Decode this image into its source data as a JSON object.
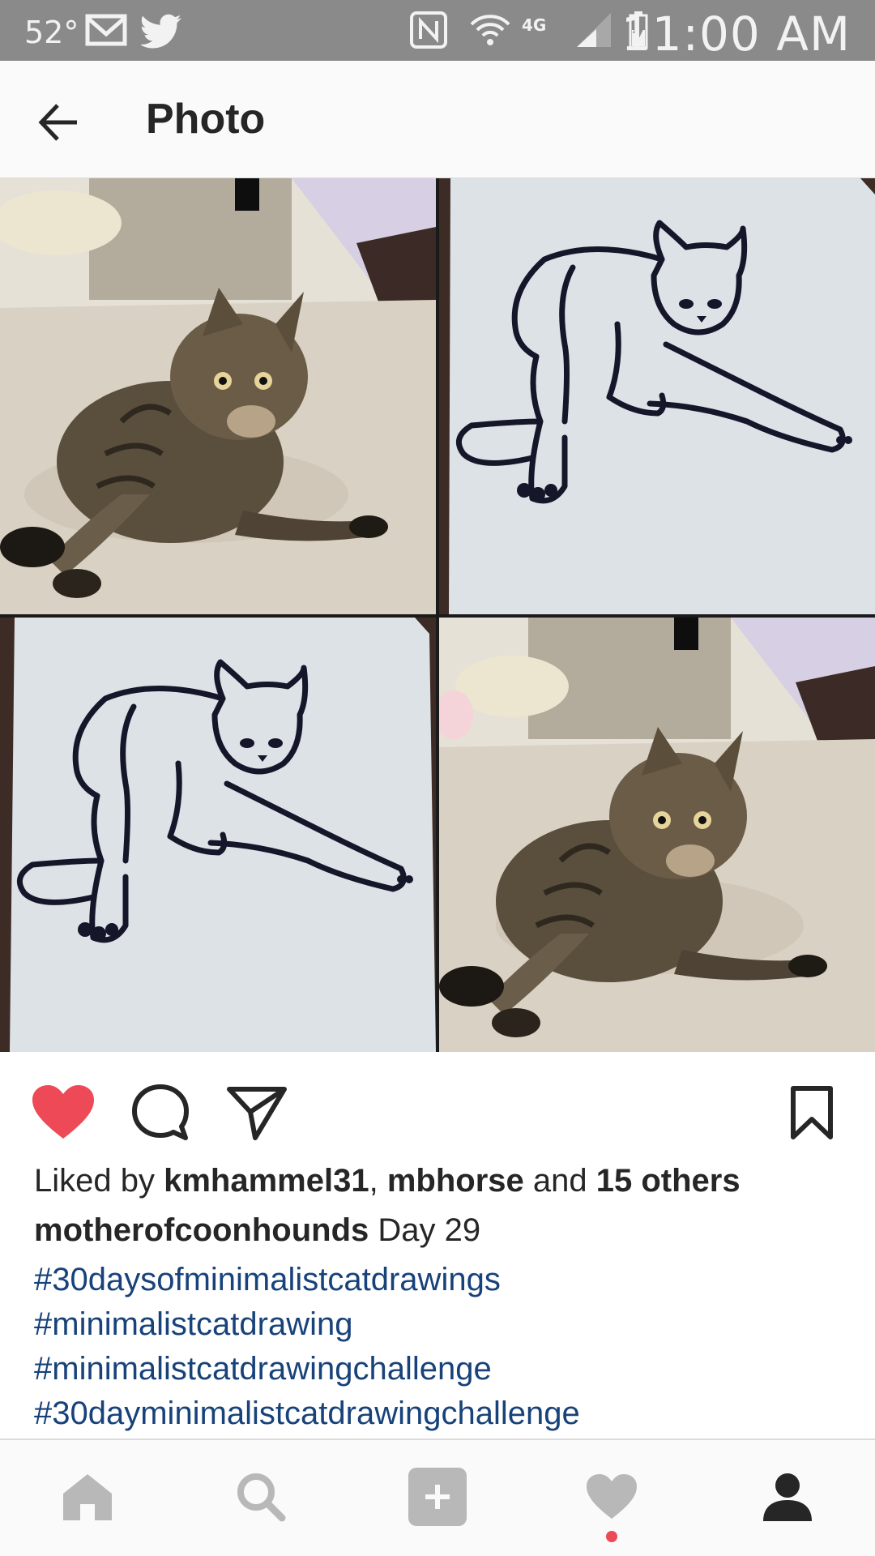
{
  "status_bar": {
    "temperature": "52°",
    "time": "11:00 AM",
    "icons": [
      "gmail-icon",
      "twitter-icon",
      "nfc-icon",
      "wifi-icon",
      "lte-icon",
      "signal-icon",
      "battery-charging-icon"
    ]
  },
  "header": {
    "title": "Photo",
    "back_icon": "arrow-left-icon"
  },
  "photo": {
    "panels": [
      "cat-photo",
      "cat-drawing",
      "cat-drawing",
      "cat-photo"
    ]
  },
  "actions": {
    "like_icon": "heart-filled-icon",
    "comment_icon": "comment-icon",
    "share_icon": "share-icon",
    "save_icon": "bookmark-icon",
    "liked": true
  },
  "likes": {
    "prefix": "Liked by ",
    "user1": "kmhammel31",
    "separator": ", ",
    "user2": "mbhorse",
    "connector": " and ",
    "others": "15 others"
  },
  "caption": {
    "username": "motherofcoonhounds",
    "text": " Day 29"
  },
  "hashtags": [
    "#30daysofminimalistcatdrawings",
    "#minimalistcatdrawing",
    "#minimalistcatdrawingchallenge",
    "#30dayminimalistcatdrawingchallenge"
  ],
  "bottom_nav": {
    "items": [
      "home-icon",
      "search-icon",
      "add-icon",
      "activity-icon",
      "profile-icon"
    ]
  },
  "colors": {
    "status_bar": "#8a8a8a",
    "like_red": "#ed4956",
    "hashtag_blue": "#17427a",
    "nav_gray": "#b8b8b8",
    "text_dark": "#262626"
  }
}
